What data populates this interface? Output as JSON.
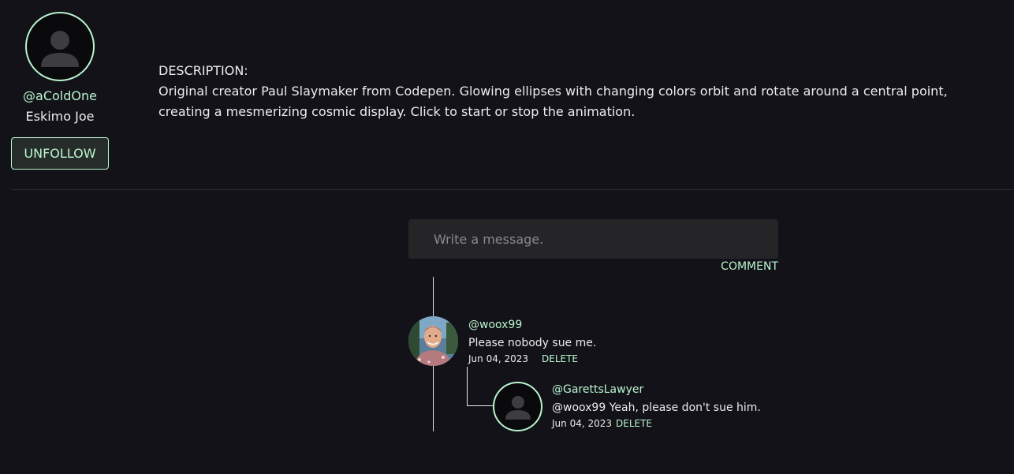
{
  "profile": {
    "handle": "@aColdOne",
    "name": "Eskimo Joe",
    "follow_button": "UNFOLLOW",
    "avatar_icon": "user-silhouette-icon"
  },
  "description": {
    "heading": "DESCRIPTION:",
    "body": "Original creator Paul Slaymaker from Codepen. Glowing ellipses with changing colors orbit and rotate around a central point, creating a mesmerizing cosmic display. Click to start or stop the animation."
  },
  "composer": {
    "placeholder": "Write a message.",
    "value": "",
    "submit_label": "COMMENT"
  },
  "comments": [
    {
      "user": "@woox99",
      "text": "Please nobody sue me.",
      "date": "Jun 04, 2023",
      "delete_label": "DELETE",
      "avatar": "user-photo"
    },
    {
      "user": "@GarettsLawyer",
      "text": "@woox99 Yeah, please don't sue him.",
      "date": "Jun 04, 2023",
      "delete_label": "DELETE",
      "avatar": "user-silhouette-icon"
    }
  ],
  "colors": {
    "background": "#131218",
    "accent": "#b9f5cf",
    "input_bg": "#252528"
  }
}
